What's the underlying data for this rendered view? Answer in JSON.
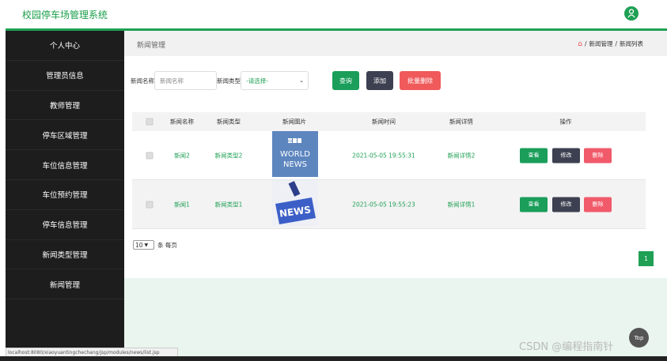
{
  "app": {
    "title": "校园停车场管理系统"
  },
  "sidebar": {
    "items": [
      {
        "label": "个人中心"
      },
      {
        "label": "管理员信息"
      },
      {
        "label": "教师管理"
      },
      {
        "label": "停车区域管理"
      },
      {
        "label": "车位信息管理"
      },
      {
        "label": "车位预约管理"
      },
      {
        "label": "停车信息管理"
      },
      {
        "label": "新闻类型管理"
      },
      {
        "label": "新闻管理"
      }
    ]
  },
  "page": {
    "title": "新闻管理",
    "breadcrumb": [
      "新闻管理",
      "新闻列表"
    ],
    "breadcrumb_sep": "/"
  },
  "search": {
    "name_label": "新闻名称",
    "name_placeholder": "新闻名称",
    "type_label": "新闻类型",
    "type_value": "-请选择-",
    "query_label": "查询",
    "add_label": "添加",
    "batch_delete_label": "批量删除"
  },
  "table": {
    "headers": [
      "新闻名称",
      "新闻类型",
      "新闻图片",
      "新闻时间",
      "新闻详情",
      "操作"
    ],
    "rows": [
      {
        "name": "新闻2",
        "type": "新闻类型2",
        "image_text": [
          "BBC",
          "WORLD",
          "NEWS"
        ],
        "time": "2021-05-05 19:55:31",
        "detail": "新闻详情2"
      },
      {
        "name": "新闻1",
        "type": "新闻类型1",
        "image_text": [
          "NEWS"
        ],
        "time": "2021-05-05 19:55:23",
        "detail": "新闻详情1"
      }
    ],
    "actions": {
      "view": "查看",
      "edit": "修改",
      "delete": "删除"
    }
  },
  "pager": {
    "page_size": "10",
    "per_page_label": "条 每页",
    "current_page": "1"
  },
  "status_url": "localhost:8080/xiaoyuantingchechang/jsp/modules/news/list.jsp",
  "top_button": "Top",
  "watermark": "CSDN @编程指南针",
  "colors": {
    "primary": "#1fa055",
    "dark_button": "#3d4050",
    "danger": "#f05a5a",
    "sidebar": "#1d1d1d"
  }
}
